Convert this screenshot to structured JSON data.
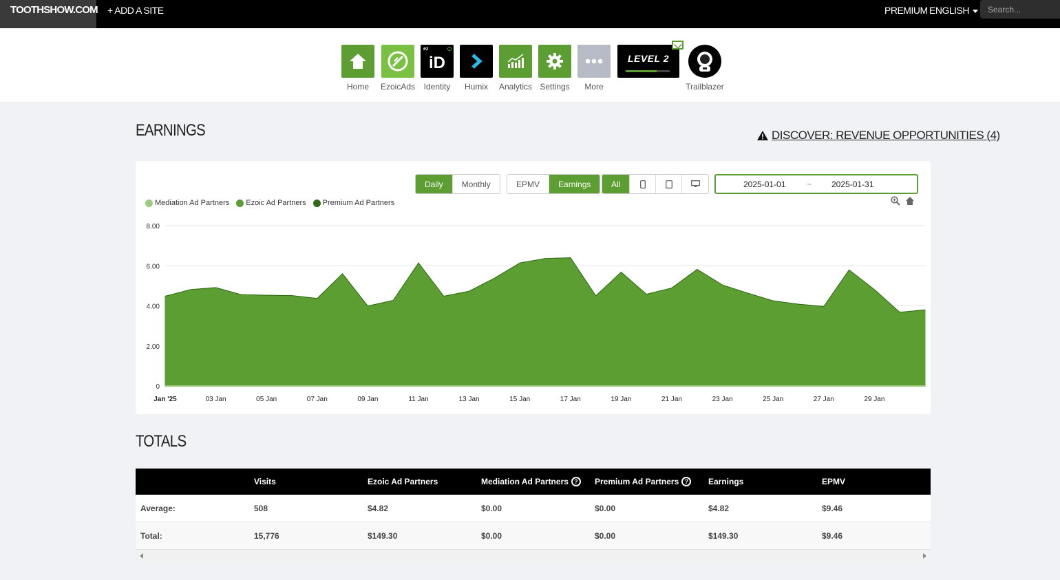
{
  "topbar": {
    "site_name": "TOOTHSHOW.COM",
    "add_site": "+ ADD A SITE",
    "premium": "PREMIUM",
    "language": "ENGLISH",
    "search_placeholder": "Search..."
  },
  "apps": [
    {
      "label": "Home",
      "icon": "home-icon"
    },
    {
      "label": "EzoicAds",
      "icon": "ezoicads-icon"
    },
    {
      "label": "Identity",
      "icon": "identity-icon"
    },
    {
      "label": "Humix",
      "icon": "humix-icon"
    },
    {
      "label": "Analytics",
      "icon": "analytics-icon"
    },
    {
      "label": "Settings",
      "icon": "gear-icon"
    },
    {
      "label": "More",
      "icon": "more-icon"
    }
  ],
  "identity_badge": "ez",
  "identity_text": "iD",
  "level": {
    "text": "LEVEL 2",
    "progress": 0.7
  },
  "trailblazer_label": "Trailblazer",
  "earnings_heading": "EARNINGS",
  "discover_link": "DISCOVER: REVENUE OPPORTUNITIES (4)",
  "controls": {
    "period": [
      {
        "label": "Daily",
        "active": true
      },
      {
        "label": "Monthly",
        "active": false
      }
    ],
    "metric": [
      {
        "label": "EPMV",
        "active": false
      },
      {
        "label": "Earnings",
        "active": true
      }
    ],
    "device_all": "All",
    "date_start": "2025-01-01",
    "date_sep": "~",
    "date_end": "2025-01-31"
  },
  "colors": {
    "accent": "#5c9e31",
    "mediation": "#9ccb7f",
    "ezoic": "#5c9e31",
    "premium": "#2f6b17"
  },
  "chart_data": {
    "type": "area",
    "stacked": true,
    "title": "",
    "xlabel": "",
    "ylabel": "",
    "ylim": [
      0,
      8
    ],
    "yticks": [
      "0",
      "2.00",
      "4.00",
      "6.00",
      "8.00"
    ],
    "x": [
      "2025-01-01",
      "2025-01-02",
      "2025-01-03",
      "2025-01-04",
      "2025-01-05",
      "2025-01-06",
      "2025-01-07",
      "2025-01-08",
      "2025-01-09",
      "2025-01-10",
      "2025-01-11",
      "2025-01-12",
      "2025-01-13",
      "2025-01-14",
      "2025-01-15",
      "2025-01-16",
      "2025-01-17",
      "2025-01-18",
      "2025-01-19",
      "2025-01-20",
      "2025-01-21",
      "2025-01-22",
      "2025-01-23",
      "2025-01-24",
      "2025-01-25",
      "2025-01-26",
      "2025-01-27",
      "2025-01-28",
      "2025-01-29",
      "2025-01-30",
      "2025-01-31"
    ],
    "xtick_labels": [
      "Jan '25",
      "03 Jan",
      "05 Jan",
      "07 Jan",
      "09 Jan",
      "11 Jan",
      "13 Jan",
      "15 Jan",
      "17 Jan",
      "19 Jan",
      "21 Jan",
      "23 Jan",
      "25 Jan",
      "27 Jan",
      "29 Jan"
    ],
    "series": [
      {
        "name": "Mediation Ad Partners",
        "values": [
          0,
          0,
          0,
          0,
          0,
          0,
          0,
          0,
          0,
          0,
          0,
          0,
          0,
          0,
          0,
          0,
          0,
          0,
          0,
          0,
          0,
          0,
          0,
          0,
          0,
          0,
          0,
          0,
          0,
          0,
          0
        ]
      },
      {
        "name": "Ezoic Ad Partners",
        "values": [
          4.48,
          4.81,
          4.91,
          4.56,
          4.53,
          4.51,
          4.37,
          5.6,
          3.99,
          4.27,
          6.14,
          4.48,
          4.73,
          5.38,
          6.14,
          6.36,
          6.4,
          4.5,
          5.68,
          4.58,
          4.89,
          5.82,
          5.04,
          4.63,
          4.25,
          4.08,
          3.97,
          5.79,
          4.81,
          3.68,
          3.8
        ]
      },
      {
        "name": "Premium Ad Partners",
        "values": [
          0,
          0,
          0,
          0,
          0,
          0,
          0,
          0,
          0,
          0,
          0,
          0,
          0,
          0,
          0,
          0,
          0,
          0,
          0,
          0,
          0,
          0,
          0,
          0,
          0,
          0,
          0,
          0,
          0,
          0,
          0
        ]
      }
    ],
    "legend": "top-left"
  },
  "totals_heading": "TOTALS",
  "totals": {
    "columns": [
      "",
      "Visits",
      "Ezoic Ad Partners",
      "Mediation Ad Partners",
      "Premium Ad Partners",
      "Earnings",
      "EPMV"
    ],
    "rows": [
      [
        "Average:",
        "508",
        "$4.82",
        "$0.00",
        "$0.00",
        "$4.82",
        "$9.46"
      ],
      [
        "Total:",
        "15,776",
        "$149.30",
        "$0.00",
        "$0.00",
        "$149.30",
        "$9.46"
      ]
    ],
    "help_icon": "?"
  }
}
